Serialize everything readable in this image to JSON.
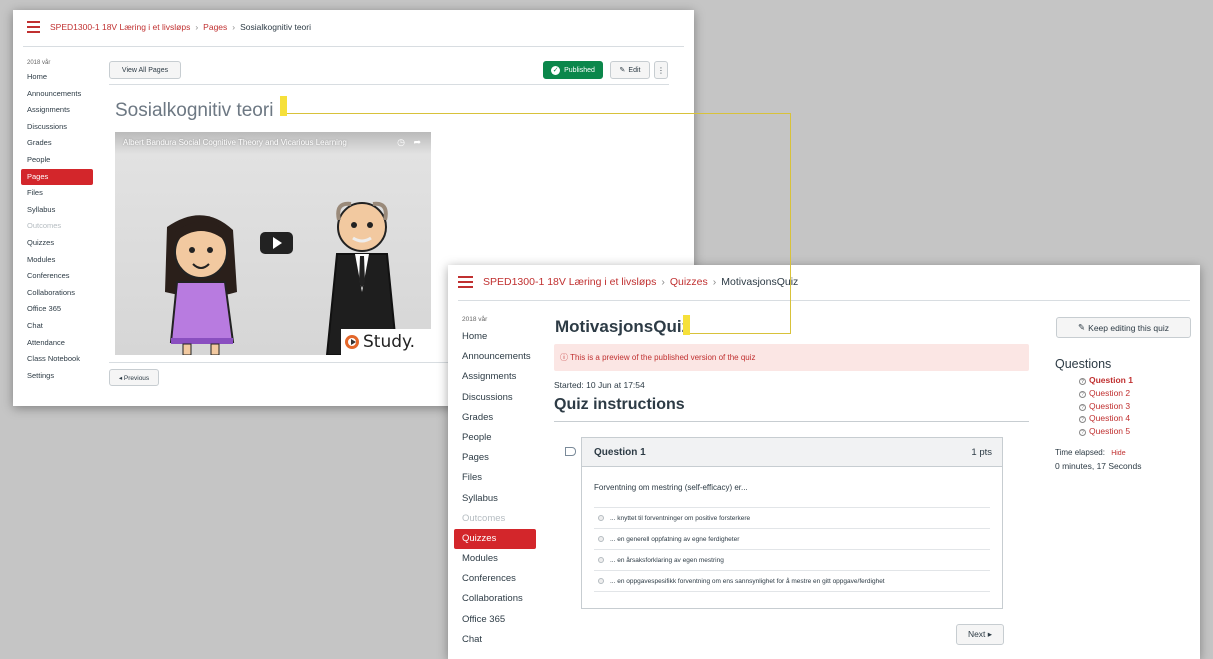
{
  "window1": {
    "breadcrumb": {
      "course": "SPED1300-1 18V Læring i et livsløps",
      "section": "Pages",
      "current": "Sosialkognitiv teori",
      "separator": "›"
    },
    "sidebar": {
      "term": "2018 vår",
      "items": [
        "Home",
        "Announcements",
        "Assignments",
        "Discussions",
        "Grades",
        "People",
        "Pages",
        "Files",
        "Syllabus",
        "Outcomes",
        "Quizzes",
        "Modules",
        "Conferences",
        "Collaborations",
        "Office 365",
        "Chat",
        "Attendance",
        "Class Notebook",
        "Settings"
      ],
      "active": "Pages",
      "disabled": "Outcomes"
    },
    "toolbar": {
      "view_all_label": "View All Pages",
      "published_label": "Published",
      "edit_label": "Edit",
      "more_label": "⋮",
      "edit_icon": "pencil-icon",
      "published_icon": "check-circle-icon"
    },
    "page_title": "Sosialkognitiv teori",
    "video": {
      "title": "Albert Bandura Social Cognitive Theory and Vicarious Learning",
      "logo_text": "Study."
    },
    "previous_label": "◂ Previous"
  },
  "window2": {
    "breadcrumb": {
      "course": "SPED1300-1 18V Læring i et livsløps",
      "section": "Quizzes",
      "current": "MotivasjonsQuiz",
      "separator": "›"
    },
    "sidebar": {
      "term": "2018 vår",
      "items": [
        "Home",
        "Announcements",
        "Assignments",
        "Discussions",
        "Grades",
        "People",
        "Pages",
        "Files",
        "Syllabus",
        "Outcomes",
        "Quizzes",
        "Modules",
        "Conferences",
        "Collaborations",
        "Office 365",
        "Chat"
      ],
      "active": "Quizzes",
      "disabled": "Outcomes"
    },
    "quiz_title": "MotivasjonsQuiz",
    "preview_notice": "ⓘ This is a preview of the published version of the quiz",
    "started": "Started: 10 Jun at 17:54",
    "instructions_heading": "Quiz instructions",
    "question": {
      "label": "Question 1",
      "points": "1 pts",
      "text": "Forventning om mestring (self-efficacy) er...",
      "answers": [
        "... knyttet til forventninger om positive forsterkere",
        "... en generell oppfatning av egne ferdigheter",
        "... en årsaksforklaring av egen mestring",
        "... en oppgavespesifikk forventning om ens sannsynlighet for å mestre en gitt oppgave/ferdighet"
      ]
    },
    "next_label": "Next ▸",
    "keep_editing_label": "Keep editing this quiz",
    "questions_heading": "Questions",
    "question_links": [
      "Question 1",
      "Question 2",
      "Question 3",
      "Question 4",
      "Question 5"
    ],
    "time_elapsed_label": "Time elapsed:",
    "hide_label": "Hide",
    "time_elapsed_value": "0 minutes, 17 Seconds"
  },
  "colors": {
    "brand_red": "#d3262b",
    "link_red": "#c03030",
    "published_green": "#0b874b",
    "highlight_yellow": "#f6e03a",
    "background_gray": "#c5c5c5"
  }
}
